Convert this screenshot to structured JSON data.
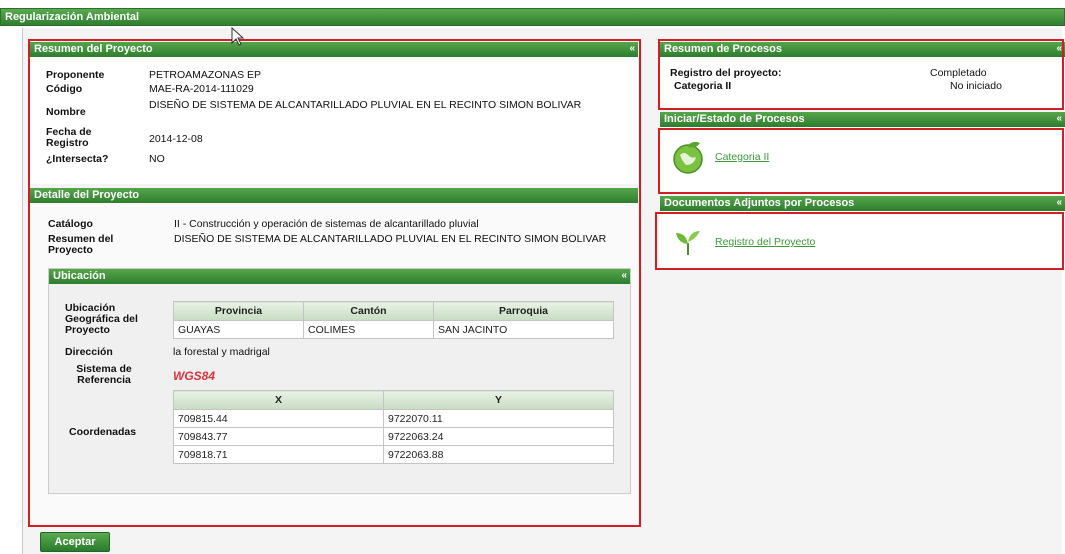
{
  "app": {
    "title": "Regularización Ambiental"
  },
  "resumen": {
    "title": "Resumen del Proyecto",
    "collapse": "«",
    "fields": [
      {
        "label": "Proponente",
        "value": "PETROAMAZONAS EP"
      },
      {
        "label": "Código",
        "value": "MAE-RA-2014-111029"
      },
      {
        "label": "Nombre",
        "value": "DISEÑO DE SISTEMA DE ALCANTARILLADO PLUVIAL EN EL RECINTO SIMON BOLIVAR"
      },
      {
        "label": "Fecha de Registro",
        "value": "2014-12-08"
      },
      {
        "label": "¿Intersecta?",
        "value": "NO"
      }
    ]
  },
  "detalle": {
    "title": "Detalle del Proyecto",
    "catalogo_label": "Catálogo",
    "catalogo_value": "II - Construcción y operación de sistemas de alcantarillado pluvial",
    "resumen_label": "Resumen del Proyecto",
    "resumen_value": "DISEÑO DE SISTEMA DE ALCANTARILLADO PLUVIAL EN EL RECINTO SIMON BOLIVAR"
  },
  "ubicacion": {
    "title": "Ubicación",
    "collapse": "«",
    "geo_label": "Ubicación Geográfica del Proyecto",
    "geo_headers": [
      "Provincia",
      "Cantón",
      "Parroquia"
    ],
    "geo_row": [
      "GUAYAS",
      "COLIMES",
      "SAN JACINTO"
    ],
    "direccion_label": "Dirección",
    "direccion_value": "la forestal y madrigal",
    "sistema_label": "Sistema de Referencia",
    "sistema_value": "WGS84",
    "coord_label": "Coordenadas",
    "coord_headers": [
      "X",
      "Y"
    ],
    "coord_rows": [
      [
        "709815.44",
        "9722070.11"
      ],
      [
        "709843.77",
        "9722063.24"
      ],
      [
        "709818.71",
        "9722063.88"
      ]
    ]
  },
  "procesos": {
    "title": "Resumen de Procesos",
    "collapse": "«",
    "rows": [
      {
        "label": "Registro del proyecto:",
        "value": "Completado"
      },
      {
        "label": "Categoria II",
        "value": "No iniciado"
      }
    ]
  },
  "iniciar": {
    "title": "Iniciar/Estado de Procesos",
    "collapse": "«",
    "link": "Categoria II"
  },
  "documentos": {
    "title": "Documentos Adjuntos por Procesos",
    "collapse": "«",
    "link": "Registro del Proyecto"
  },
  "actions": {
    "accept": "Aceptar"
  },
  "colors": {
    "header_green": "#3e8f3e",
    "link_green": "#3b9b3b",
    "highlight_red": "#d21f26",
    "wgs_red": "#e0303a"
  }
}
